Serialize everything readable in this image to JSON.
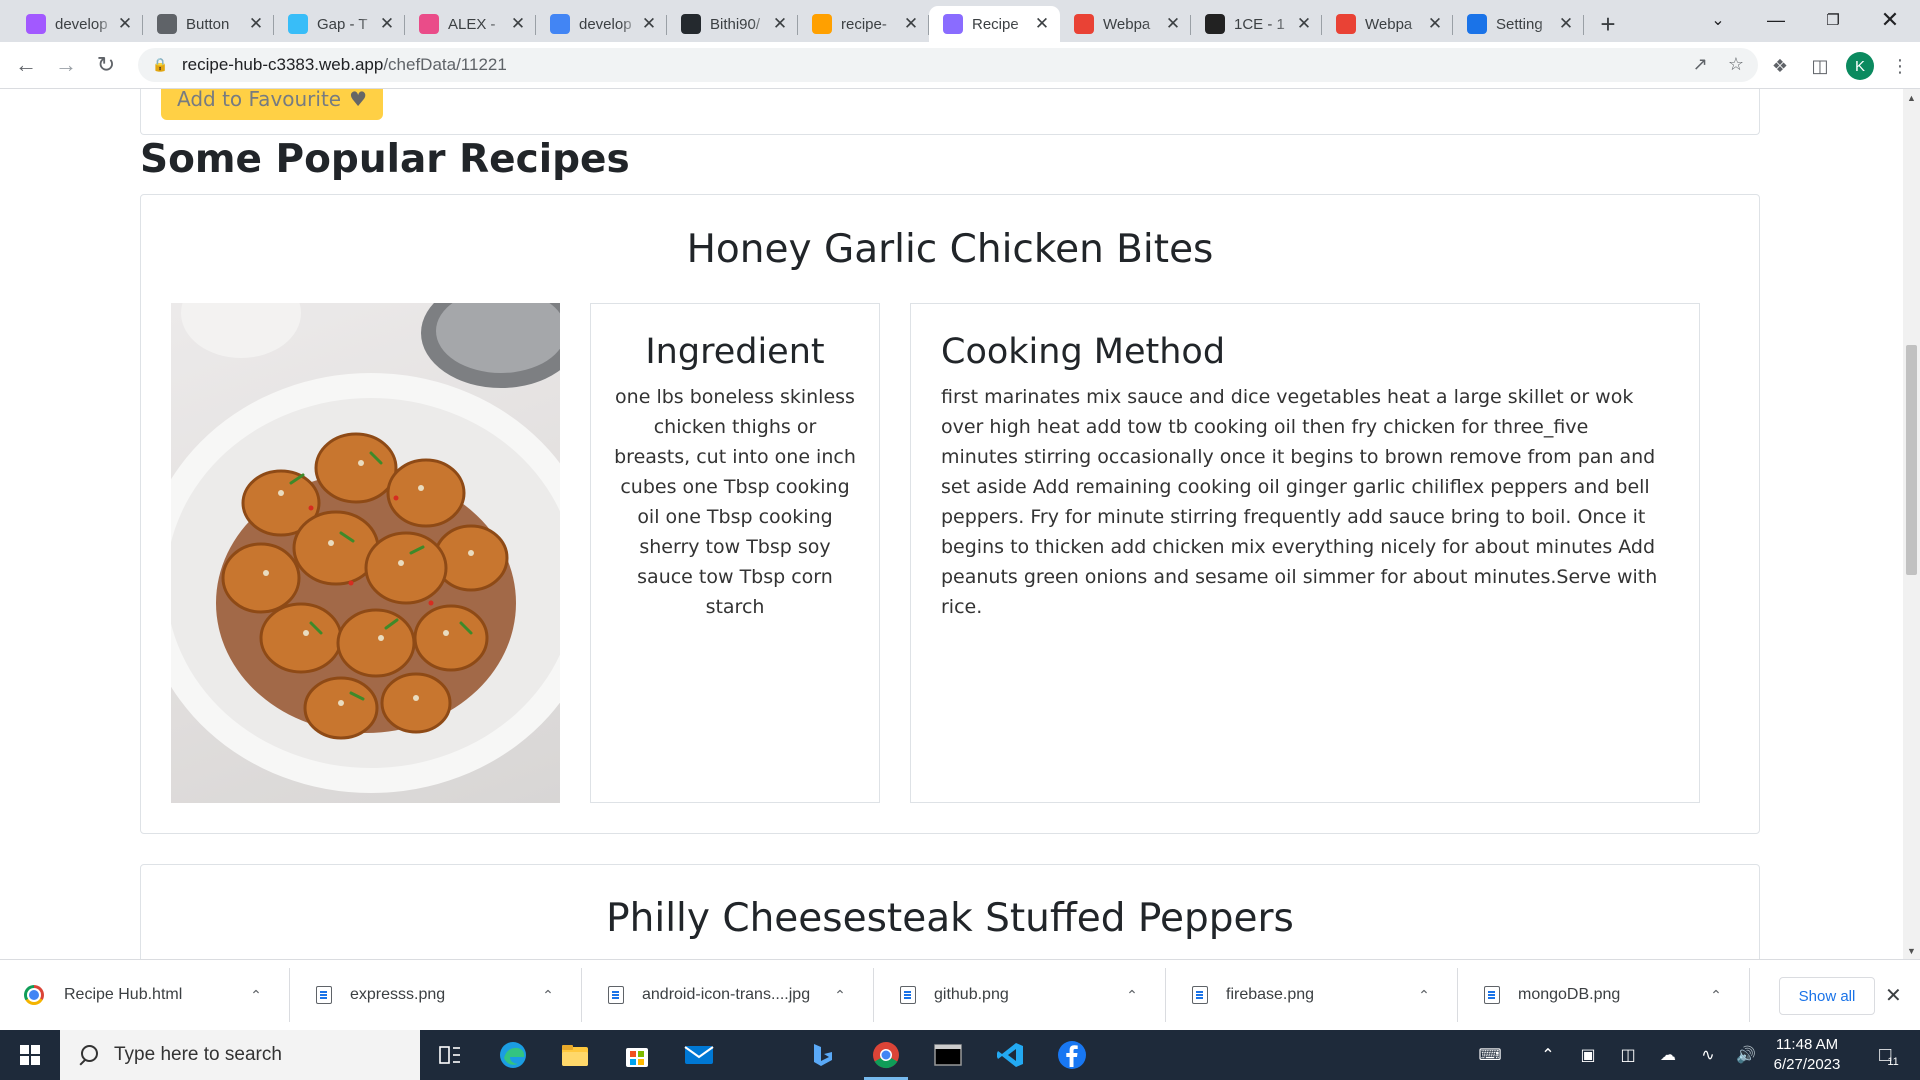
{
  "browser": {
    "tabs": [
      {
        "title": "develop",
        "icon": "figma-icon",
        "color": "#a259ff",
        "active": false
      },
      {
        "title": "Button",
        "icon": "profile-icon",
        "color": "#5f6368",
        "active": false
      },
      {
        "title": "Gap - T",
        "icon": "tailwind-icon",
        "color": "#38bdf8",
        "active": false
      },
      {
        "title": "ALEX -",
        "icon": "dribbble-icon",
        "color": "#ea4c89",
        "active": false
      },
      {
        "title": "develop",
        "icon": "google-icon",
        "color": "#4285f4",
        "active": false
      },
      {
        "title": "Bithi90/",
        "icon": "github-icon",
        "color": "#24292e",
        "active": false
      },
      {
        "title": "recipe-",
        "icon": "firebase-icon",
        "color": "#ffa000",
        "active": false
      },
      {
        "title": "Recipe",
        "icon": "vite-icon",
        "color": "#8a6cff",
        "active": true
      },
      {
        "title": "Webpa",
        "icon": "rainbow-icon",
        "color": "#e94235",
        "active": false
      },
      {
        "title": "1CE - 1",
        "icon": "camera-icon",
        "color": "#222222",
        "active": false
      },
      {
        "title": "Webpa",
        "icon": "rainbow-icon",
        "color": "#e94235",
        "active": false
      },
      {
        "title": "Setting",
        "icon": "gear-icon",
        "color": "#1a73e8",
        "active": false
      }
    ],
    "url_host": "recipe-hub-c3383.web.app",
    "url_path": "/chefData/11221",
    "profile_initial": "K"
  },
  "page": {
    "favourite_button": "Add to Favourite",
    "section_title": "Some Popular Recipes",
    "recipes": [
      {
        "title": "Honey Garlic Chicken Bites",
        "ingredient_heading": "Ingredient",
        "ingredients": "one lbs boneless skinless chicken thighs or breasts, cut into one inch cubes one Tbsp cooking oil one Tbsp cooking sherry tow Tbsp soy sauce tow Tbsp corn starch",
        "method_heading": "Cooking Method",
        "method": "first marinates mix sauce and dice vegetables heat a large skillet or wok over high heat add tow tb cooking oil then fry chicken for three_five minutes stirring occasionally once it begins to brown remove from pan and set aside Add remaining cooking oil ginger garlic chiliflex peppers and bell peppers. Fry for minute stirring frequently add sauce bring to boil. Once it begins to thicken add chicken mix everything nicely for about minutes Add peanuts green onions and sesame oil simmer for about minutes.Serve with rice."
      },
      {
        "title": "Philly Cheesesteak Stuffed Peppers"
      }
    ]
  },
  "downloads": {
    "items": [
      "Recipe Hub.html",
      "expresss.png",
      "android-icon-trans....jpg",
      "github.png",
      "firebase.png",
      "mongoDB.png"
    ],
    "show_all": "Show all"
  },
  "taskbar": {
    "search_placeholder": "Type here to search",
    "time": "11:48 AM",
    "date": "6/27/2023",
    "notification_count": "11"
  }
}
